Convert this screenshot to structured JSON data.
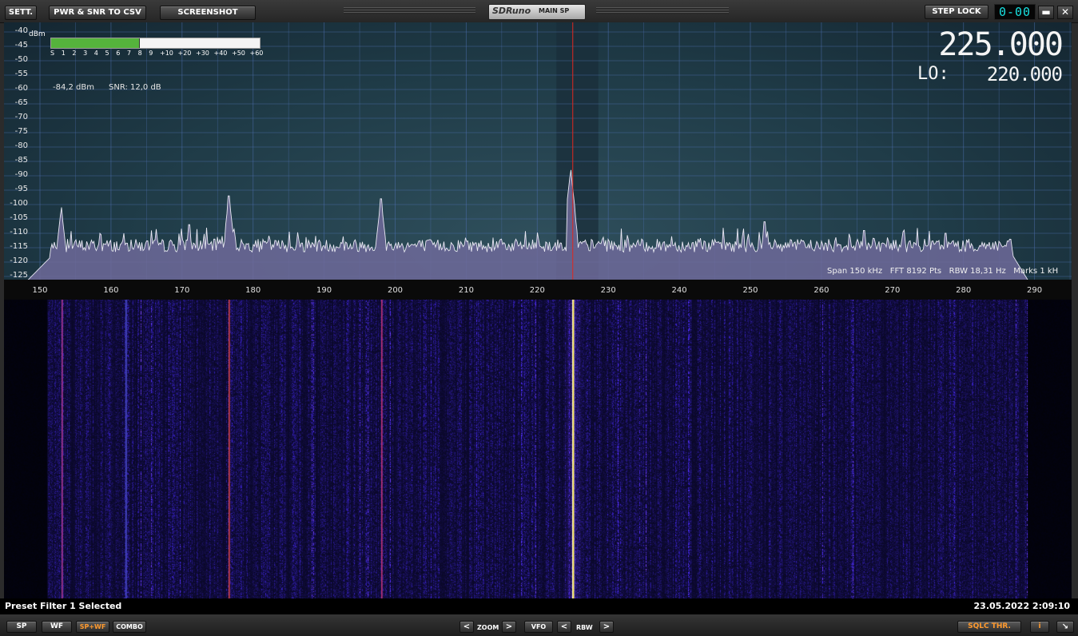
{
  "toolbar": {
    "settings_label": "SETT.",
    "pwr_snr_label": "PWR & SNR TO CSV",
    "screenshot_label": "SCREENSHOT",
    "app_name": "SDRuno",
    "window_name": "MAIN SP",
    "step_lock_label": "STEP LOCK",
    "digits_display": "0-00",
    "minimize_label": "▬",
    "close_label": "✕"
  },
  "meter": {
    "unit": "dBm",
    "scale": [
      "S",
      "1",
      "2",
      "3",
      "4",
      "5",
      "6",
      "7",
      "8",
      "9",
      "+10",
      "+20",
      "+30",
      "+40",
      "+50",
      "+60"
    ],
    "level_fraction": 0.42,
    "reading": "-84,2 dBm",
    "snr": "SNR: 12,0 dB"
  },
  "frequency": {
    "main": "225.000",
    "lo_label": "LO:",
    "lo_value": "220.000"
  },
  "spectrum": {
    "y_labels": [
      "-40",
      "-45",
      "-50",
      "-55",
      "-60",
      "-65",
      "-70",
      "-75",
      "-80",
      "-85",
      "-90",
      "-95",
      "-100",
      "-105",
      "-110",
      "-115",
      "-120",
      "-125"
    ],
    "x_labels": [
      "150",
      "160",
      "170",
      "180",
      "190",
      "200",
      "210",
      "220",
      "230",
      "240",
      "250",
      "260",
      "270",
      "280",
      "290"
    ],
    "info": "Span 150 kHz   FFT 8192 Pts   RBW 18,31 Hz   Marks 1 kH",
    "colors": {
      "fill": "#6e6a9a",
      "trace": "#e8e8f2",
      "marker": "#e0261d"
    }
  },
  "status": {
    "message": "Preset Filter 1 Selected",
    "datetime": "23.05.2022 2:09:10"
  },
  "bottom": {
    "sp_label": "SP",
    "wf_label": "WF",
    "spwf_label": "SP+WF",
    "combo_label": "COMBO",
    "zoom_label": "ZOOM",
    "vfo_label": "VFO",
    "rbw_label": "RBW",
    "left_arrow": "<",
    "right_arrow": ">",
    "sqlc_label": "SQLC THR.",
    "info_label": "i",
    "resize_label": "↘"
  }
}
